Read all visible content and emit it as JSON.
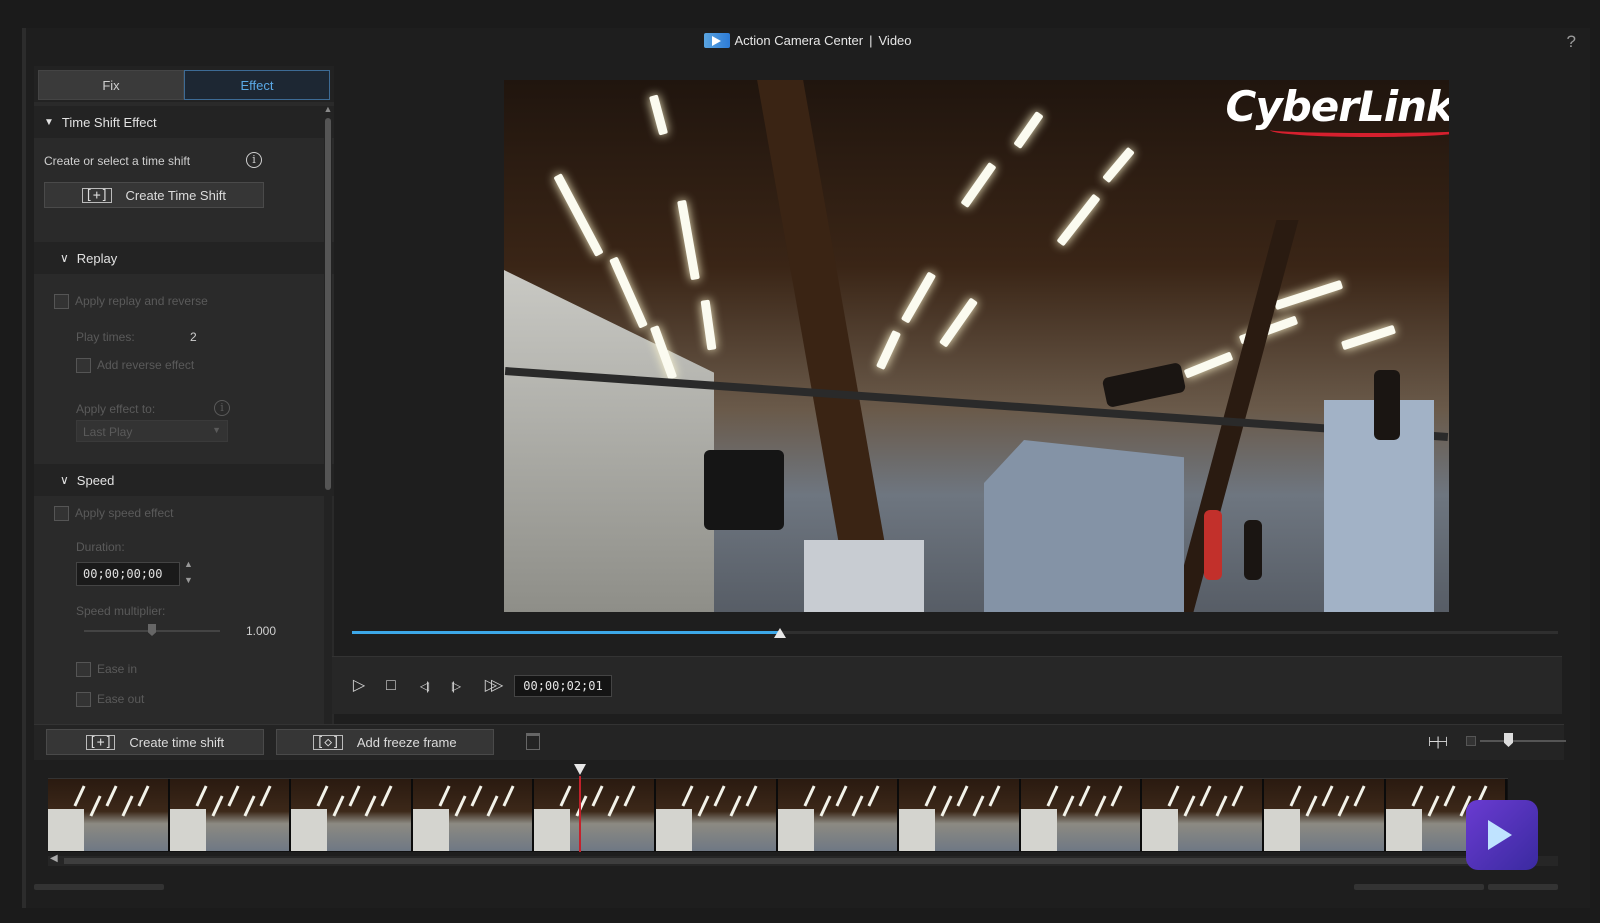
{
  "window": {
    "app_name": "Action Camera Center",
    "separator": "|",
    "mode": "Video",
    "help_label": "?"
  },
  "tabs": [
    {
      "label": "Fix",
      "active": false
    },
    {
      "label": "Effect",
      "active": true
    }
  ],
  "time_shift": {
    "header": "Time Shift Effect",
    "prompt": "Create or select a time shift",
    "create_button": "Create Time Shift",
    "icon_bracket": "[+]"
  },
  "replay": {
    "header": "Replay",
    "apply_label": "Apply replay and reverse",
    "play_times_label": "Play times:",
    "play_times_value": "2",
    "reverse_label": "Add reverse effect",
    "apply_to_label": "Apply effect to:",
    "apply_to_value": "Last Play"
  },
  "speed": {
    "header": "Speed",
    "apply_label": "Apply speed effect",
    "duration_label": "Duration:",
    "duration_value": "00;00;00;00",
    "multiplier_label": "Speed multiplier:",
    "multiplier_value": "1.000",
    "multiplier_position": 0.5,
    "ease_in_label": "Ease in",
    "ease_out_label": "Ease out"
  },
  "preview": {
    "watermark": "CyberLink",
    "progress": 0.355
  },
  "playback": {
    "timecode": "00;00;02;01",
    "play_icon": "▷",
    "stop_icon": "□",
    "prev_frame_icon": "◁|",
    "next_frame_icon": "|▷",
    "fast_forward_icon": "▷▷"
  },
  "timeline": {
    "create_time_shift": "Create time shift",
    "add_freeze_frame": "Add freeze frame",
    "create_icon": "[+]",
    "freeze_icon": "[◇]",
    "fit_icon": "⊢|⊣",
    "frame_count": 12
  },
  "colors": {
    "accent": "#3da8e8",
    "playhead": "#c3212b",
    "watermark_swoosh": "#d5202e"
  }
}
